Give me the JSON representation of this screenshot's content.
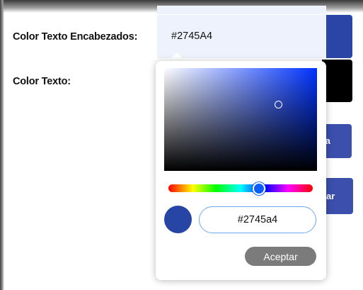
{
  "form": {
    "heading_color_label": "Color Texto Encabezados:",
    "heading_color_value": "#2745A4",
    "text_color_label": "Color Texto:",
    "side_button_1_label": "ia",
    "side_button_2_label": "ar"
  },
  "picker": {
    "hex_value": "#2745a4",
    "accept_label": "Aceptar",
    "selected_color": "#2745a4",
    "hue_color": "#0033ff",
    "hue_fraction": 0.63,
    "saturation": 0.76,
    "brightness": 0.64
  },
  "colors": {
    "heading_swatch": "#2b45a6",
    "text_swatch": "#000000",
    "button_bg": "#3c4fad",
    "input_focus_border": "#6aa9f0"
  }
}
